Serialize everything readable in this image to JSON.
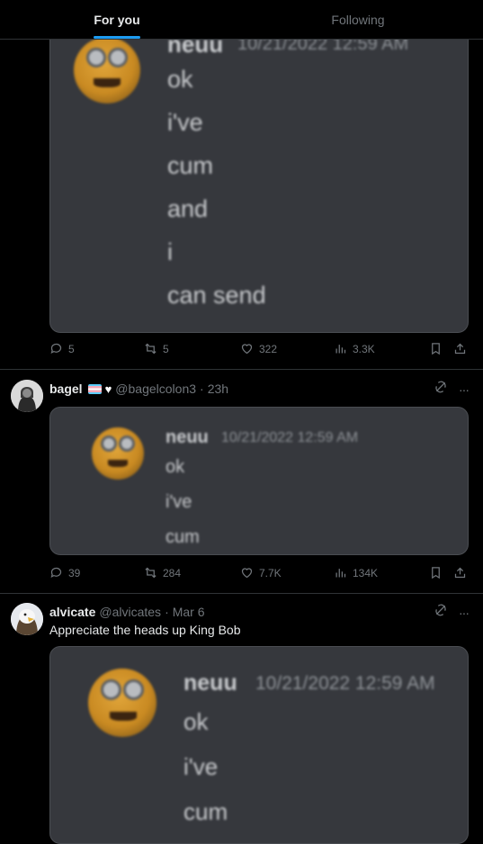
{
  "tabs": {
    "for_you": "For you",
    "following": "Following"
  },
  "message": {
    "author": "neuu",
    "timestamp": "10/21/2022 12:59 AM"
  },
  "post1": {
    "lines": [
      "ok",
      "i've",
      "cum",
      "and",
      "i",
      "can send"
    ],
    "timestamp": "10/21/2022 12:59 AM",
    "stats": {
      "replies": "5",
      "reposts": "5",
      "likes": "322",
      "views": "3.3K"
    }
  },
  "post2": {
    "username": "bagel",
    "handle": "@bagelcolon3",
    "time": "23h",
    "lines": [
      "ok",
      "i've",
      "cum"
    ],
    "stats": {
      "replies": "39",
      "reposts": "284",
      "likes": "7.7K",
      "views": "134K"
    }
  },
  "post3": {
    "username": "alvicate",
    "handle": "@alvicates",
    "time": "Mar 6",
    "text": "Appreciate the heads up King Bob",
    "lines": [
      "ok",
      "i've",
      "cum"
    ]
  },
  "separator": "·",
  "more": "···",
  "colors": {
    "accent": "#1d9bf0",
    "card": "#36383d",
    "muted": "#71767b",
    "text": "#e7e9ea"
  },
  "icons": [
    "reply-icon",
    "repost-icon",
    "like-icon",
    "views-icon",
    "bookmark-icon",
    "share-icon",
    "grok-icon",
    "more-icon"
  ]
}
